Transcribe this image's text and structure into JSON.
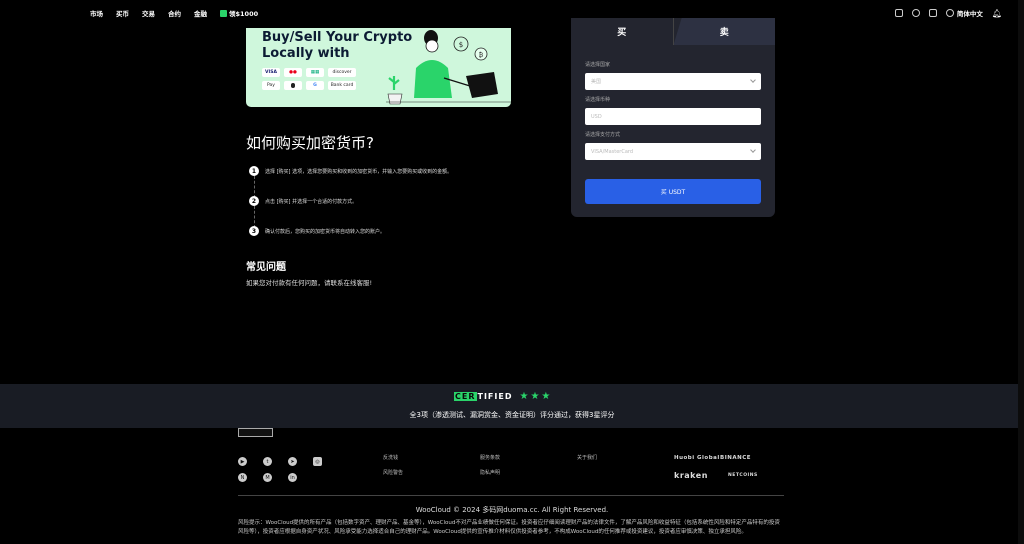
{
  "nav": {
    "items": [
      "市场",
      "买币",
      "交易",
      "合约",
      "金融"
    ],
    "promo": "领$1000"
  },
  "header": {
    "language": "简体中文"
  },
  "hero": {
    "title_line1": "Buy/Sell Your Crypto",
    "title_line2": "Locally with",
    "payment_badges": [
      "VISA",
      "●●",
      "▦▦",
      "discover",
      "Pay",
      "",
      "G",
      "Bank card"
    ]
  },
  "howto": {
    "title": "如何购买加密货币?",
    "steps": [
      {
        "num": "1",
        "text": "选择 [购买] 选项，选择您要购买和收到的加密货币，并输入您要购买或收到的金额。"
      },
      {
        "num": "2",
        "text": "点击 [购买] 并选择一个合适的付款方式。"
      },
      {
        "num": "3",
        "text": "确认付款后，您购买的加密货币将自动转入您的账户。"
      }
    ]
  },
  "faq": {
    "title": "常见问题",
    "desc": "如果您对付款有任何问题，请联系在线客服!"
  },
  "panel": {
    "tab_buy": "买",
    "tab_sell": "卖",
    "country_label": "请选择国家",
    "country_value": "美国",
    "currency_label": "请选择币种",
    "currency_value": "USD",
    "payment_label": "请选择支付方式",
    "payment_value": "VISA/MasterCard",
    "buy_button": "买 USDT"
  },
  "certified": {
    "logo_left": "CER",
    "logo_right": "TIFIED",
    "stars": "★★★",
    "text": "全3项（渗透测试、漏洞赏金、资金证明）评分通过，获得3星评分"
  },
  "footer": {
    "links_col1": [
      "反洗钱",
      "风险警告"
    ],
    "links_col2": [
      "服务条款",
      "隐私声明"
    ],
    "links_col3": [
      "关于我们"
    ],
    "partners": [
      "Huobi Global",
      "BINANCE",
      "kraken",
      "NETCOINS"
    ],
    "copyright": "WooCloud © 2024 多码网duoma.cc. All Right Reserved.",
    "risk": "风险提示：WooCloud提供的所有产品（包括数字资产、理财产品、基金等），WooCloud不对产品业绩做任何保证。投资者应仔细阅读理财产品的法律文件，了解产品风险和收益特征（包括系统性风险和特定产品特有的投资风险等），投资者应根据自身资产状况、风险承受能力选择适合自己的理财产品。WooCloud提供的宣传推介材料仅供投资者参考，不构成WooCloud的任何推荐或投资建议，投资者应审慎决策、独立承担风险。"
  },
  "colors": {
    "accent_green": "#2ad46a",
    "button_blue": "#2960e6",
    "panel_bg": "#23252f",
    "hero_bg": "#cff7dc"
  }
}
